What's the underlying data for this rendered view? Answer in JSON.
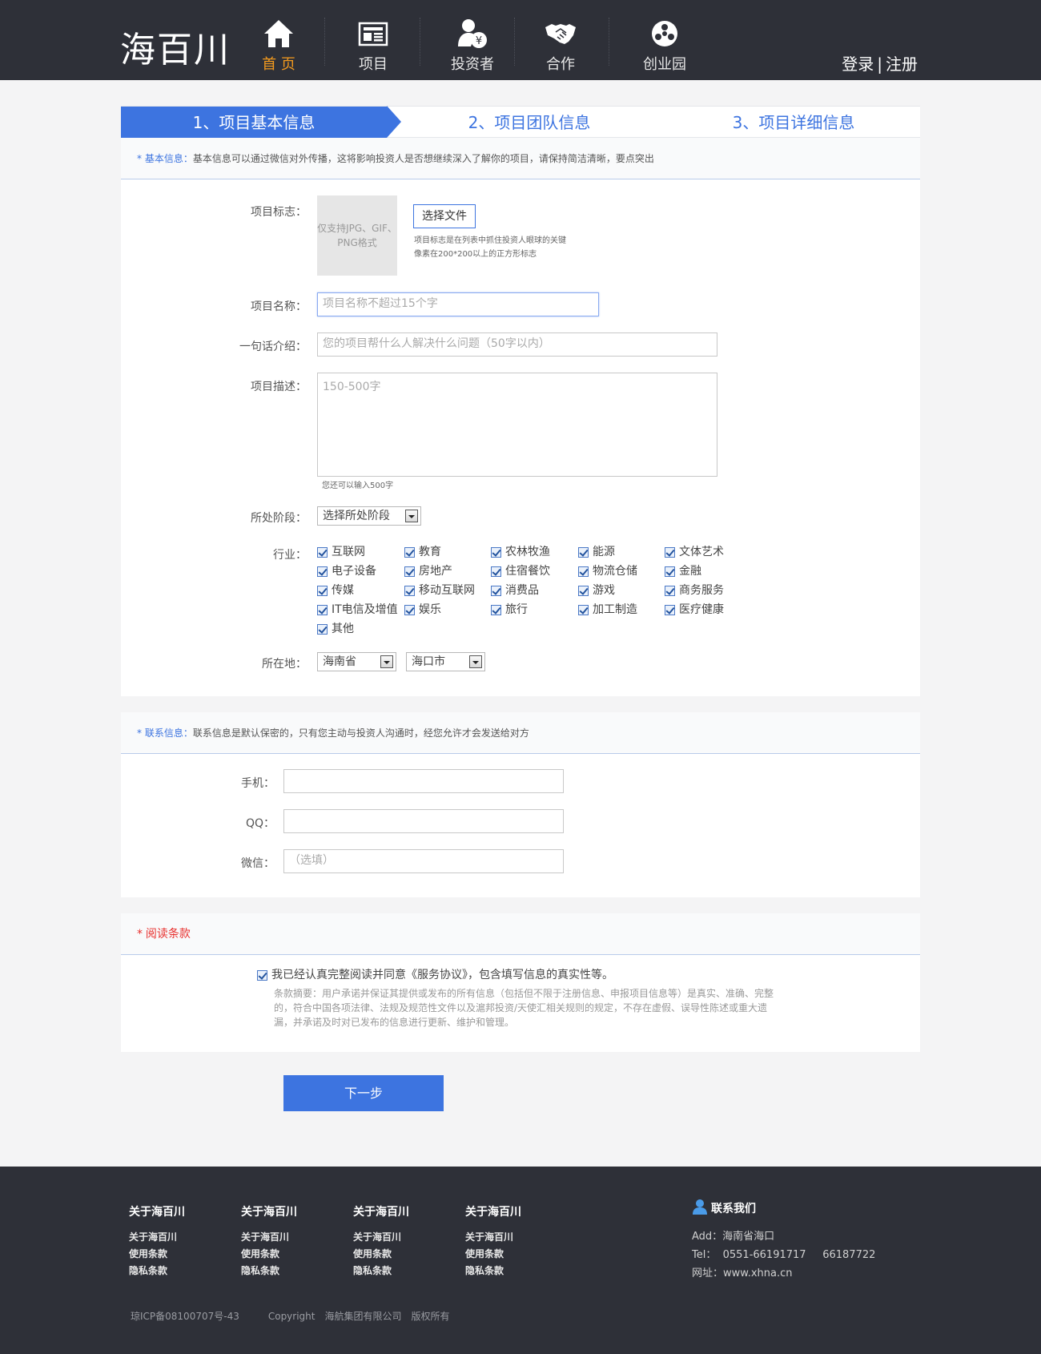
{
  "header": {
    "logo": "海百川",
    "nav": [
      {
        "label": "首 页",
        "icon": "home-icon"
      },
      {
        "label": "项目",
        "icon": "newspaper-icon"
      },
      {
        "label": "投资者",
        "icon": "investor-icon"
      },
      {
        "label": "合作",
        "icon": "handshake-icon"
      },
      {
        "label": "创业园",
        "icon": "park-icon"
      }
    ],
    "login": "登录",
    "sep": "|",
    "register": "注册",
    "colors": {
      "bg": "#2e3038",
      "active": "#f39a1e"
    }
  },
  "steps": [
    "1、项目基本信息",
    "2、项目团队信息",
    "3、项目详细信息"
  ],
  "basic": {
    "star": "*",
    "title": "基本信息：",
    "desc": "基本信息可以通过微信对外传播，这将影响投资人是否想继续深入了解你的项目，请保持简洁清晰，要点突出",
    "logo_label": "项目标志：",
    "upload_text": "仅支持JPG、GIF、PNG格式",
    "file_button": "选择文件",
    "logo_tip1": "项目标志是在列表中抓住投资人眼球的关键",
    "logo_tip2": "像素在200*200以上的正方形标志",
    "name_label": "项目名称：",
    "name_placeholder": "项目名称不超过15个字",
    "intro_label": "一句话介绍：",
    "intro_placeholder": "您的项目帮什么人解决什么问题（50字以内）",
    "desc_label": "项目描述：",
    "desc_placeholder": "150-500字",
    "desc_counter": "您还可以输入500字",
    "stage_label": "所处阶段：",
    "stage_value": "选择所处阶段",
    "industry_label": "行业：",
    "industries": [
      [
        "互联网",
        "教育",
        "农林牧渔",
        "能源",
        "文体艺术"
      ],
      [
        "电子设备",
        "房地产",
        "住宿餐饮",
        "物流仓储",
        "金融"
      ],
      [
        "传媒",
        "移动互联网",
        "消费品",
        "游戏",
        "商务服务"
      ],
      [
        "IT电信及增值",
        "娱乐",
        "旅行",
        "加工制造",
        "医疗健康"
      ],
      [
        "其他"
      ]
    ],
    "location_label": "所在地：",
    "province": "海南省",
    "city": "海口市"
  },
  "contact": {
    "star": "*",
    "title": "联系信息：",
    "desc": "联系信息是默认保密的，只有您主动与投资人沟通时，经您允许才会发送给对方",
    "phone_label": "手机：",
    "qq_label": "QQ：",
    "wechat_label": "微信：",
    "wechat_placeholder": "（选填）"
  },
  "terms": {
    "star": "*",
    "title": "阅读条款",
    "agree": "我已经认真完整阅读并同意《服务协议》，包含填写信息的真实性等。",
    "summary1": "条款摘要：用户承诺并保证其提供或发布的所有信息（包括但不限于注册信息、申报项目信息等）是真实、准确、完整",
    "summary2": "的，符合中国各项法律、法规及规范性文件以及滬邦投资/天使汇相关规则的规定，不存在虚假、误导性陈述或重大遗",
    "summary3": "漏，并承诺及时对已发布的信息进行更新、维护和管理。"
  },
  "next_button": "下一步",
  "footer": {
    "cols": [
      {
        "title": "关于海百川",
        "items": [
          "关于海百川",
          "使用条款",
          "隐私条款"
        ]
      },
      {
        "title": "关于海百川",
        "items": [
          "关于海百川",
          "使用条款",
          "隐私条款"
        ]
      },
      {
        "title": "关于海百川",
        "items": [
          "关于海百川",
          "使用条款",
          "隐私条款"
        ]
      },
      {
        "title": "关于海百川",
        "items": [
          "关于海百川",
          "使用条款",
          "隐私条款"
        ]
      }
    ],
    "contact_title": "联系我们",
    "address": "Add：海南省海口",
    "tel": "Tel：  0551-66191717     66187722",
    "web": "网址：www.xhna.cn",
    "icp": "琼ICP备08100707号-43",
    "copyright": "Copyright",
    "company": "海航集团有限公司",
    "rights": "版权所有"
  }
}
